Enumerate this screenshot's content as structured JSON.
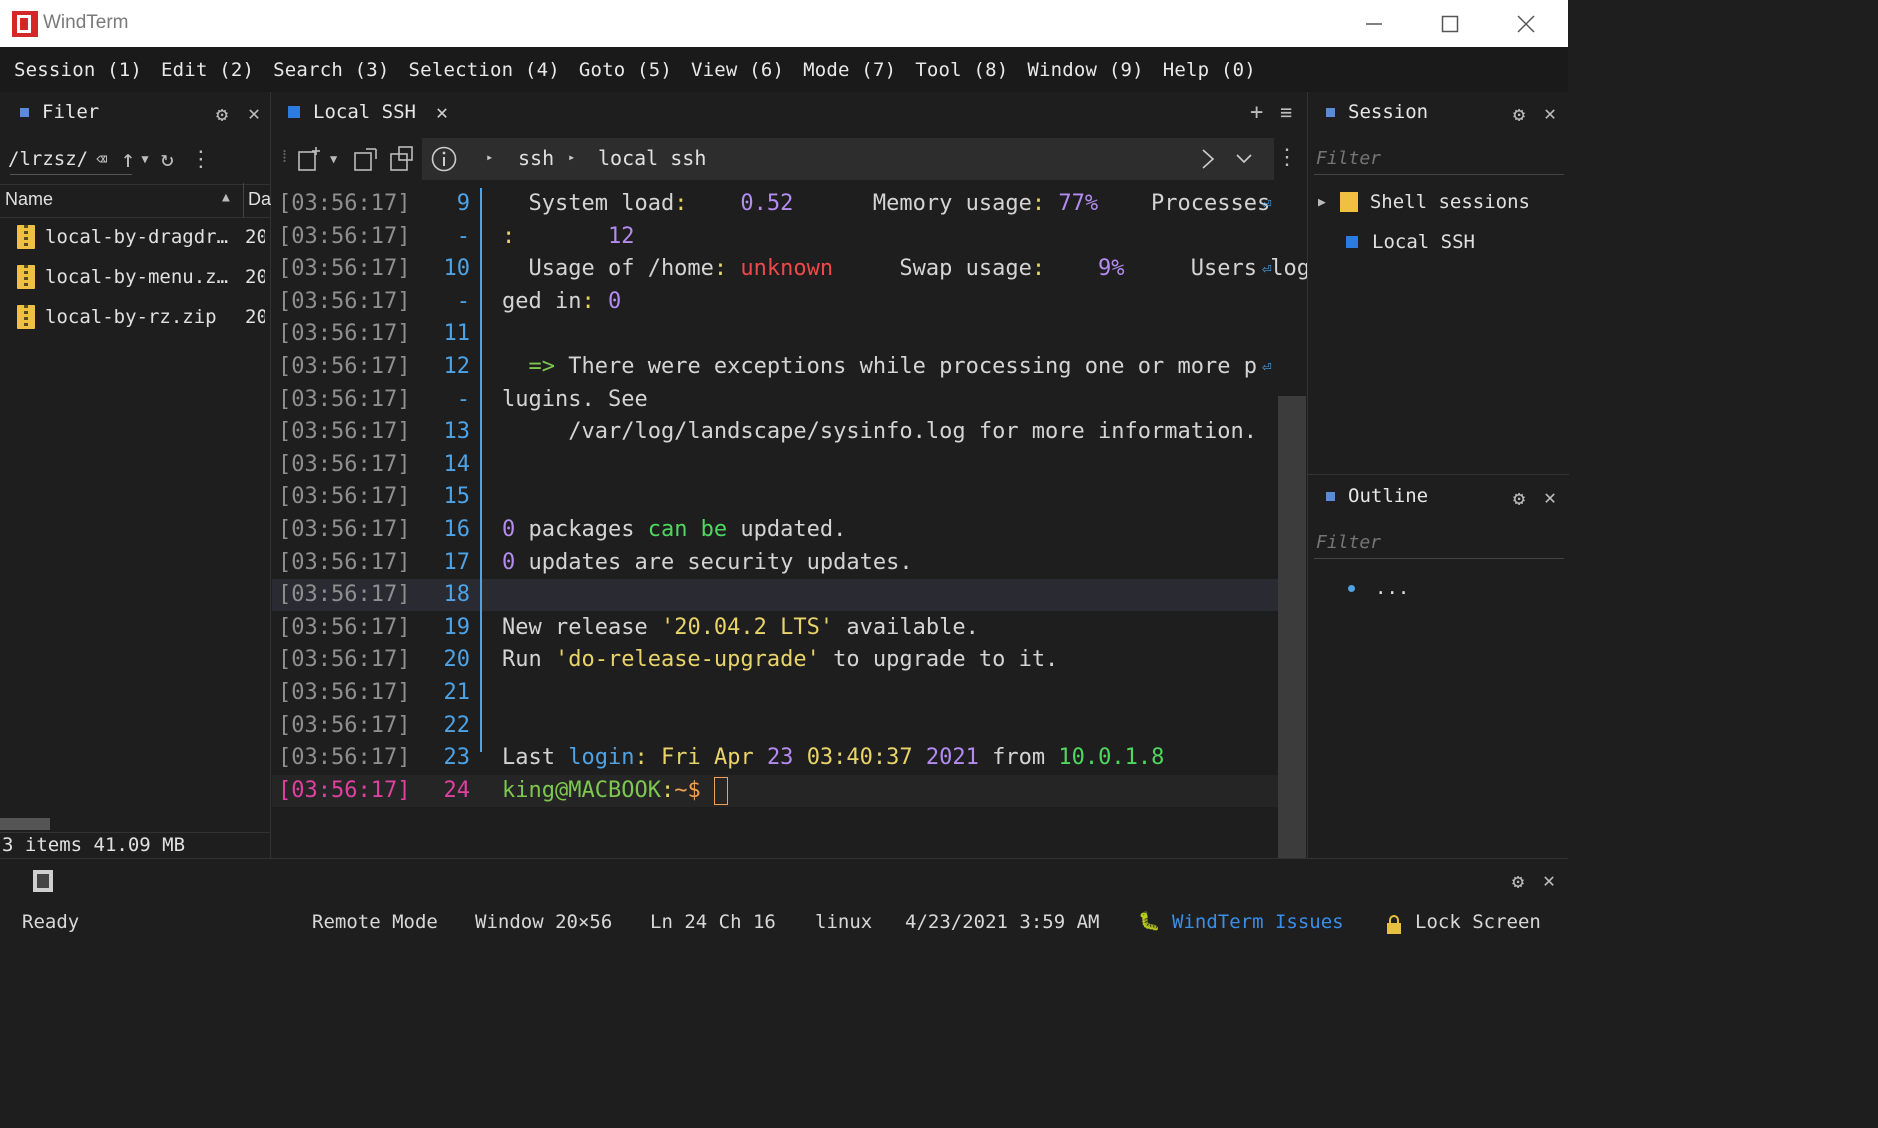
{
  "window": {
    "title": "WindTerm"
  },
  "menu": [
    "Session (1)",
    "Edit (2)",
    "Search (3)",
    "Selection (4)",
    "Goto (5)",
    "View (6)",
    "Mode (7)",
    "Tool (8)",
    "Window (9)",
    "Help (0)"
  ],
  "filer": {
    "title": "Filer",
    "path": "/lrzsz/",
    "col_name": "Name",
    "col_date": "Da",
    "files": [
      {
        "name": "local-by-dragdr…",
        "date": "20"
      },
      {
        "name": "local-by-menu.z…",
        "date": "20"
      },
      {
        "name": "local-by-rz.zip",
        "date": "20"
      }
    ],
    "summary": "3 items 41.09 MB"
  },
  "tab": {
    "label": "Local SSH"
  },
  "breadcrumb": {
    "part1": "ssh",
    "part2": "local ssh"
  },
  "terminal": {
    "timestamp": "[03:56:17]",
    "lines": [
      {
        "n": "9",
        "segs": [
          {
            "t": "  System load",
            "c": ""
          },
          {
            "t": ":",
            "c": "c-yellow"
          },
          {
            "t": "    0.52",
            "c": "c-purple"
          },
          {
            "t": "      Memory usage",
            "c": ""
          },
          {
            "t": ":",
            "c": "c-yellow"
          },
          {
            "t": " 77%",
            "c": "c-purple"
          },
          {
            "t": "    Processes",
            "c": ""
          }
        ],
        "wrap": true
      },
      {
        "n": "-",
        "segs": [
          {
            "t": ":",
            "c": "c-yellow"
          },
          {
            "t": "       12",
            "c": "c-purple"
          }
        ]
      },
      {
        "n": "10",
        "segs": [
          {
            "t": "  Usage of /home",
            "c": ""
          },
          {
            "t": ":",
            "c": "c-yellow"
          },
          {
            "t": " unknown",
            "c": "c-red"
          },
          {
            "t": "     Swap usage",
            "c": ""
          },
          {
            "t": ":",
            "c": "c-yellow"
          },
          {
            "t": "    9%",
            "c": "c-purple"
          },
          {
            "t": "     Users log",
            "c": ""
          }
        ],
        "wrap": true
      },
      {
        "n": "-",
        "segs": [
          {
            "t": "ged in",
            "c": ""
          },
          {
            "t": ":",
            "c": "c-yellow"
          },
          {
            "t": " 0",
            "c": "c-purple"
          }
        ]
      },
      {
        "n": "11",
        "segs": []
      },
      {
        "n": "12",
        "segs": [
          {
            "t": "  => ",
            "c": "c-green"
          },
          {
            "t": "There were exceptions while processing one or more p",
            "c": ""
          }
        ],
        "wrap": true
      },
      {
        "n": "-",
        "segs": [
          {
            "t": "lugins. See",
            "c": ""
          }
        ]
      },
      {
        "n": "13",
        "segs": [
          {
            "t": "     /var/log/landscape/sysinfo.log for more information.",
            "c": ""
          }
        ]
      },
      {
        "n": "14",
        "segs": []
      },
      {
        "n": "15",
        "segs": []
      },
      {
        "n": "16",
        "segs": [
          {
            "t": "0",
            "c": "c-purple"
          },
          {
            "t": " packages ",
            "c": ""
          },
          {
            "t": "can be",
            "c": "c-lgreen"
          },
          {
            "t": " updated.",
            "c": ""
          }
        ]
      },
      {
        "n": "17",
        "segs": [
          {
            "t": "0",
            "c": "c-purple"
          },
          {
            "t": " updates are security updates.",
            "c": ""
          }
        ]
      },
      {
        "n": "18",
        "segs": []
      },
      {
        "n": "19",
        "segs": [
          {
            "t": "New release ",
            "c": ""
          },
          {
            "t": "'20.04.2 LTS'",
            "c": "c-yellow"
          },
          {
            "t": " available.",
            "c": ""
          }
        ]
      },
      {
        "n": "20",
        "segs": [
          {
            "t": "Run ",
            "c": ""
          },
          {
            "t": "'do-release-upgrade'",
            "c": "c-yellow"
          },
          {
            "t": " to upgrade to it.",
            "c": ""
          }
        ]
      },
      {
        "n": "21",
        "segs": []
      },
      {
        "n": "22",
        "segs": []
      },
      {
        "n": "23",
        "segs": [
          {
            "t": "Last ",
            "c": ""
          },
          {
            "t": "login",
            "c": "c-blue"
          },
          {
            "t": ": ",
            "c": "c-yellow"
          },
          {
            "t": "Fri Apr ",
            "c": "c-yellow"
          },
          {
            "t": "23",
            "c": "c-purple"
          },
          {
            "t": " ",
            "c": ""
          },
          {
            "t": "03:40:37",
            "c": "c-yellow"
          },
          {
            "t": " ",
            "c": ""
          },
          {
            "t": "2021",
            "c": "c-purple"
          },
          {
            "t": " from ",
            "c": ""
          },
          {
            "t": "10.0.1.8",
            "c": "c-lgreen"
          }
        ]
      },
      {
        "n": "24",
        "segs": [
          {
            "t": "king@MACBOOK",
            "c": "c-green"
          },
          {
            "t": ":",
            "c": "c-yellow"
          },
          {
            "t": "~$",
            "c": "c-orange"
          },
          {
            "t": " ",
            "c": ""
          }
        ],
        "prompt": true
      }
    ]
  },
  "session_panel": {
    "title": "Session",
    "filter_placeholder": "Filter",
    "folder": "Shell sessions",
    "item": "Local SSH"
  },
  "outline_panel": {
    "title": "Outline",
    "filter_placeholder": "Filter",
    "item": "..."
  },
  "status": {
    "ready": "Ready",
    "mode": "Remote Mode",
    "window": "Window 20×56",
    "position": "Ln 24 Ch 16",
    "os": "linux",
    "datetime": "4/23/2021 3:59 AM",
    "issues": "WindTerm Issues",
    "lock": "Lock Screen"
  },
  "colors": {
    "accent": "#2b7be0",
    "line_number": "#4ea3e6",
    "prompt_time": "#e040a0"
  }
}
